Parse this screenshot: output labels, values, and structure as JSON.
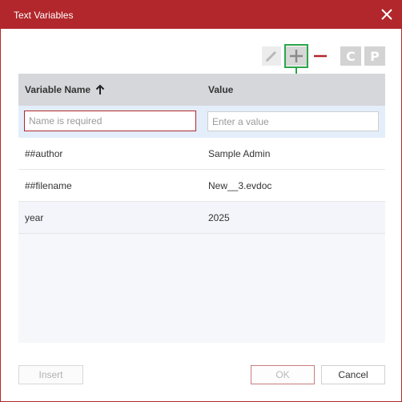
{
  "dialog": {
    "title": "Text Variables"
  },
  "colors": {
    "accent": "#b1272c",
    "highlight": "#2ca54a",
    "header_bg": "#d6d7db",
    "edit_row_bg": "#e3eefa"
  },
  "toolbar": {
    "edit_icon": "pencil-icon",
    "add_icon": "plus-icon",
    "remove_icon": "minus-icon",
    "c_label": "C",
    "p_label": "P"
  },
  "grid": {
    "columns": {
      "name": "Variable Name",
      "value": "Value"
    },
    "sort_icon": "arrow-up-icon",
    "new_row": {
      "name_placeholder": "Name is required",
      "value_placeholder": "Enter a value"
    },
    "rows": [
      {
        "name": "##author",
        "value": "Sample Admin"
      },
      {
        "name": "##filename",
        "value": "New__3.evdoc"
      },
      {
        "name": "year",
        "value": "2025"
      }
    ]
  },
  "footer": {
    "insert_label": "Insert",
    "ok_label": "OK",
    "cancel_label": "Cancel"
  }
}
